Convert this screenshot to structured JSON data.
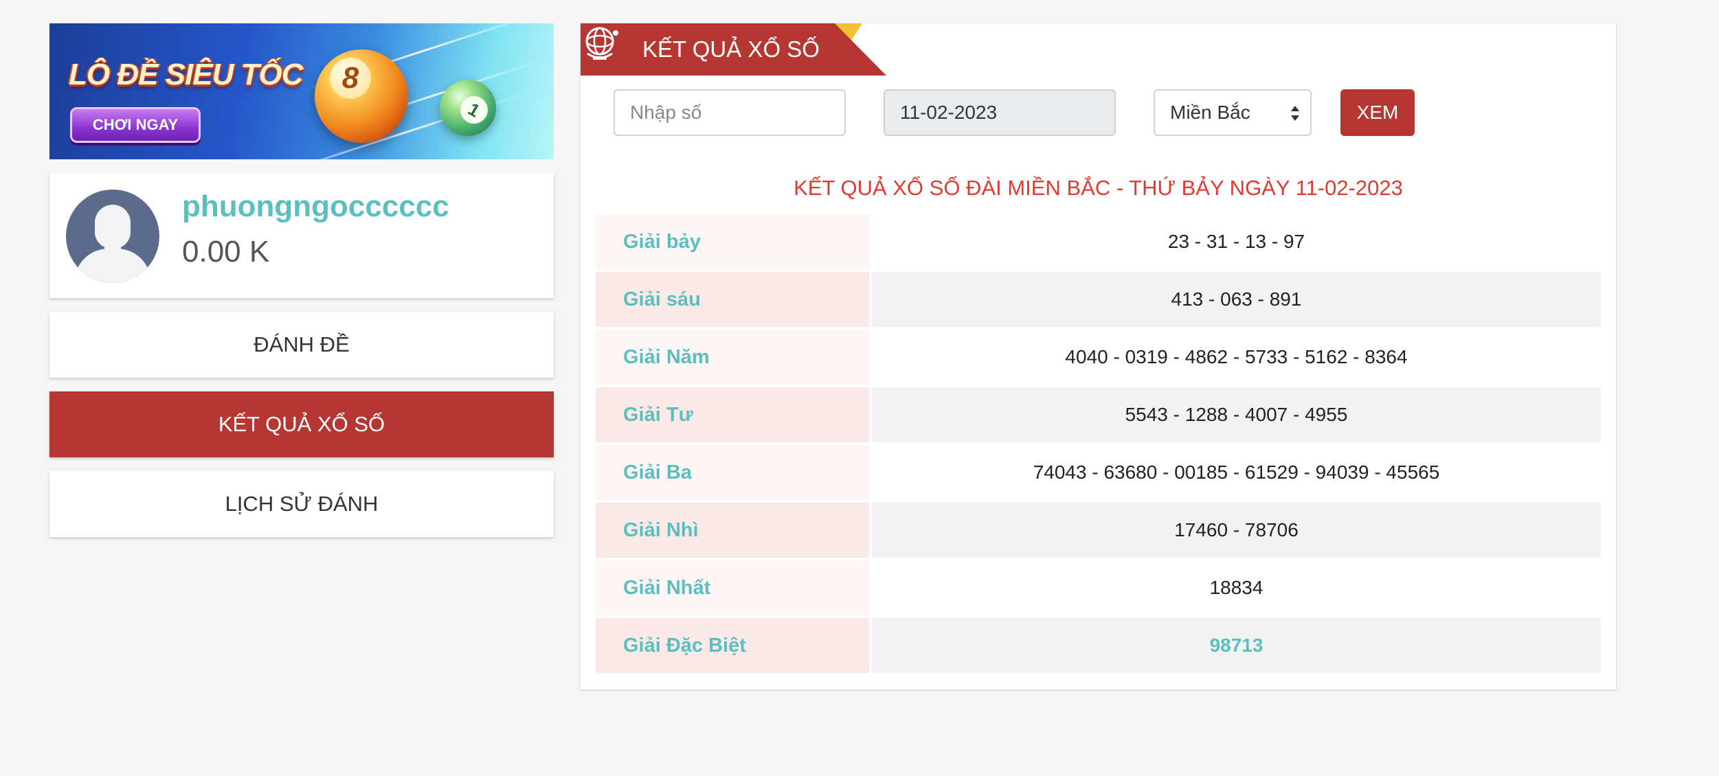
{
  "banner": {
    "title": "LÔ ĐỀ SIÊU TỐC",
    "cta": "CHƠI NGAY",
    "ball_number": "8"
  },
  "profile": {
    "username": "phuongngocccccc",
    "balance": "0.00 K"
  },
  "menu": {
    "items": [
      {
        "label": "ĐÁNH ĐỀ",
        "active": false
      },
      {
        "label": "KẾT QUẢ XỔ SỐ",
        "active": true
      },
      {
        "label": "LỊCH SỬ ĐÁNH",
        "active": false
      }
    ]
  },
  "panel": {
    "title": "KẾT QUẢ XỔ SỐ",
    "number_input_placeholder": "Nhập số",
    "date_value": "11-02-2023",
    "region_value": "Miền Bắc",
    "submit_label": "XEM",
    "result_heading": "KẾT QUẢ XỔ SỐ ĐÀI MIỀN BẮC - THỨ BẢY NGÀY 11-02-2023"
  },
  "results": [
    {
      "label": "Giải bảy",
      "value": "23 - 31 - 13 - 97"
    },
    {
      "label": "Giải sáu",
      "value": "413 - 063 - 891"
    },
    {
      "label": "Giải Năm",
      "value": "4040 - 0319 - 4862 - 5733 - 5162 - 8364"
    },
    {
      "label": "Giải Tư",
      "value": "5543 - 1288 - 4007 - 4955"
    },
    {
      "label": "Giải Ba",
      "value": "74043 - 63680 - 00185 - 61529 - 94039 - 45565"
    },
    {
      "label": "Giải Nhì",
      "value": "17460 - 78706"
    },
    {
      "label": "Giải Nhất",
      "value": "18834"
    },
    {
      "label": "Giải Đặc Biệt",
      "value": "98713"
    }
  ],
  "colors": {
    "accent_red": "#b63632",
    "heading_red": "#e03a2f",
    "teal": "#5bbfbf",
    "gold_ribbon": "#f2c232"
  }
}
